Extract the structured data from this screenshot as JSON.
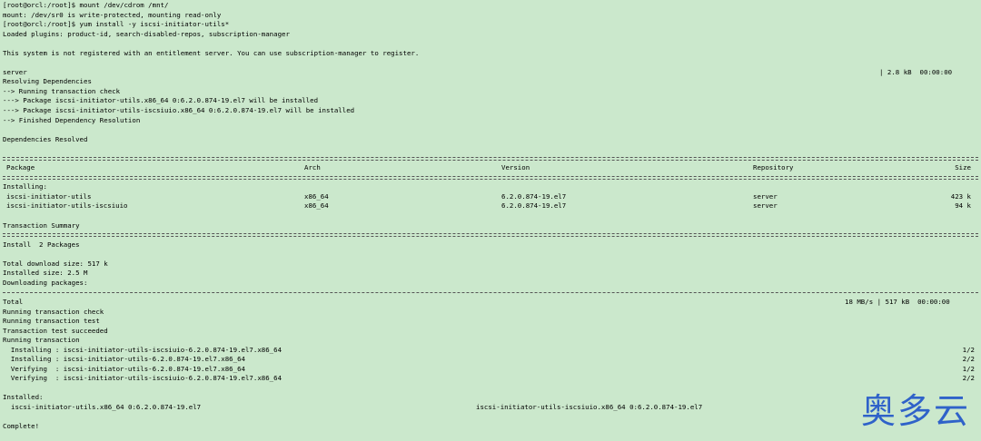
{
  "terminal": {
    "lines": [
      "[root@orcl:/root]$ mount /dev/cdrom /mnt/",
      "mount: /dev/sr0 is write-protected, mounting read-only",
      "[root@orcl:/root]$ yum install -y iscsi-initiator-utils*",
      "Loaded plugins: product-id, search-disabled-repos, subscription-manager",
      "",
      "This system is not registered with an entitlement server. You can use subscription-manager to register."
    ],
    "server_line": {
      "label": "server",
      "right": "| 2.8 kB  00:00:00"
    },
    "resolve_lines": [
      "Resolving Dependencies",
      "--> Running transaction check",
      "---> Package iscsi-initiator-utils.x86_64 0:6.2.0.874-19.el7 will be installed",
      "---> Package iscsi-initiator-utils-iscsiuio.x86_64 0:6.2.0.874-19.el7 will be installed",
      "--> Finished Dependency Resolution",
      "",
      "Dependencies Resolved"
    ],
    "table": {
      "headers": {
        "package": "Package",
        "arch": "Arch",
        "version": "Version",
        "repository": "Repository",
        "size": "Size"
      },
      "installing_label": "Installing:",
      "rows": [
        {
          "package": "iscsi-initiator-utils",
          "arch": "x86_64",
          "version": "6.2.0.874-19.el7",
          "repository": "server",
          "size": "423 k"
        },
        {
          "package": "iscsi-initiator-utils-iscsiuio",
          "arch": "x86_64",
          "version": "6.2.0.874-19.el7",
          "repository": "server",
          "size": "94 k"
        }
      ]
    },
    "summary_title": "Transaction Summary",
    "summary_lines": [
      "Install  2 Packages",
      "",
      "Total download size: 517 k",
      "Installed size: 2.5 M",
      "Downloading packages:"
    ],
    "total_line": {
      "label": "Total",
      "right": "18 MB/s | 517 kB  00:00:00"
    },
    "run_lines": [
      "Running transaction check",
      "Running transaction test",
      "Transaction test succeeded",
      "Running transaction"
    ],
    "steps": [
      {
        "text": "  Installing : iscsi-initiator-utils-iscsiuio-6.2.0.874-19.el7.x86_64",
        "count": "1/2"
      },
      {
        "text": "  Installing : iscsi-initiator-utils-6.2.0.874-19.el7.x86_64",
        "count": "2/2"
      },
      {
        "text": "  Verifying  : iscsi-initiator-utils-6.2.0.874-19.el7.x86_64",
        "count": "1/2"
      },
      {
        "text": "  Verifying  : iscsi-initiator-utils-iscsiuio-6.2.0.874-19.el7.x86_64",
        "count": "2/2"
      }
    ],
    "installed_title": "Installed:",
    "installed_pkg1": "iscsi-initiator-utils.x86_64 0:6.2.0.874-19.el7",
    "installed_pkg2": "iscsi-initiator-utils-iscsiuio.x86_64 0:6.2.0.874-19.el7",
    "complete": "Complete!"
  },
  "watermark": "奥多云"
}
